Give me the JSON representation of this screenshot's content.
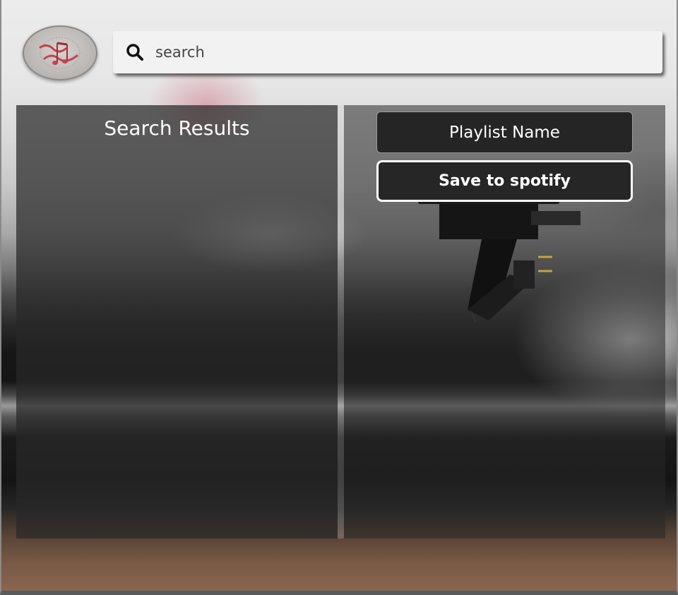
{
  "header": {
    "logo_icon": "music-notes-logo",
    "search": {
      "placeholder": "search",
      "value": "",
      "icon": "search-icon"
    }
  },
  "results": {
    "title": "Search Results",
    "items": []
  },
  "playlist": {
    "name_value": "Playlist Name",
    "save_label": "Save to spotify",
    "tracks": []
  },
  "colors": {
    "panel_bg": "#282828",
    "accent_logo": "#c2424e",
    "text": "#ffffff"
  }
}
